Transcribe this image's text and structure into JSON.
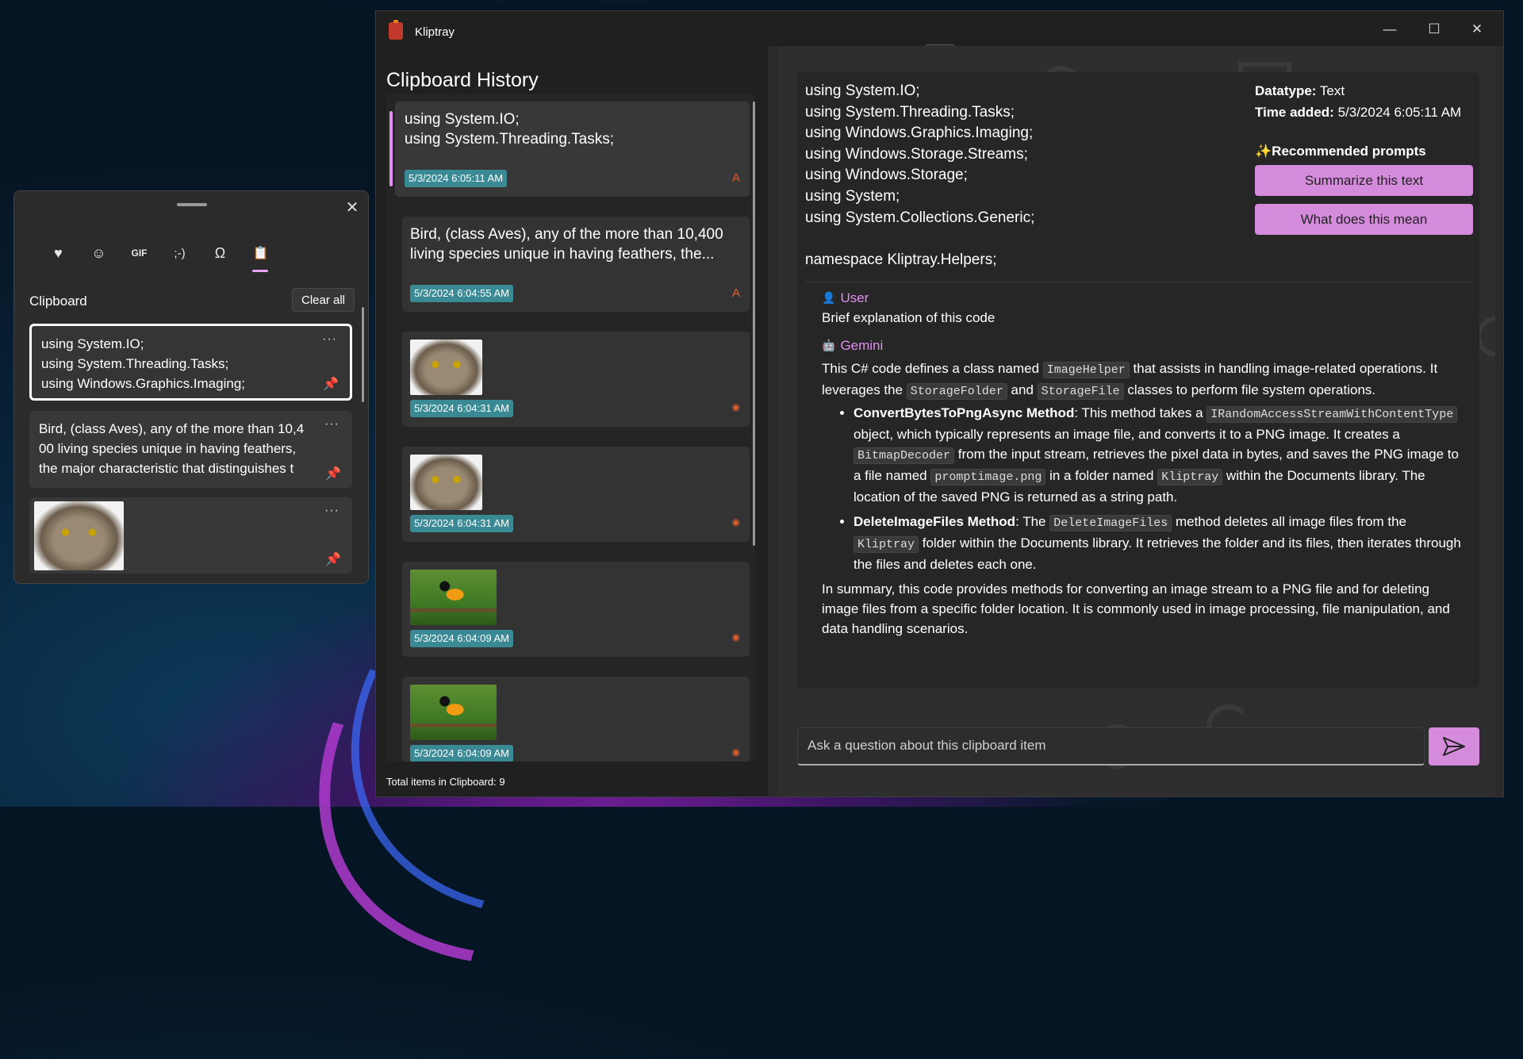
{
  "flyout": {
    "close_icon": "✕",
    "tabs": [
      {
        "name": "favorites-icon",
        "glyph": "♥"
      },
      {
        "name": "emoji-icon",
        "glyph": "☺"
      },
      {
        "name": "gif-icon",
        "glyph": "GIF"
      },
      {
        "name": "kaomoji-icon",
        "glyph": ";-)"
      },
      {
        "name": "symbols-icon",
        "glyph": "Ω"
      },
      {
        "name": "clipboard-icon",
        "glyph": "📋"
      }
    ],
    "heading": "Clipboard",
    "clear_all": "Clear all",
    "items": [
      {
        "text": "using System.IO;\nusing System.Threading.Tasks;\nusing Windows.Graphics.Imaging;"
      },
      {
        "text": "Bird, (class Aves), any of the more than 10,4\n00 living species unique in having feathers,\nthe major characteristic that distinguishes t"
      },
      {
        "text": ""
      }
    ],
    "more_icon": "···",
    "pin_icon": "📌"
  },
  "app": {
    "title": "Kliptray",
    "minimize": "—",
    "maximize": "☐",
    "close": "✕",
    "history_title": "Clipboard History",
    "cards": [
      {
        "text": "using System.IO;\nusing System.Threading.Tasks;",
        "time": "5/3/2024 6:05:11 AM",
        "type": "A"
      },
      {
        "text": "Bird, (class Aves), any of the more than 10,400\nliving species unique in having feathers, the...",
        "time": "5/3/2024 6:04:55 AM",
        "type": "A"
      },
      {
        "text": "",
        "time": "5/3/2024 6:04:31 AM",
        "type": "◉"
      },
      {
        "text": "",
        "time": "5/3/2024 6:04:31 AM",
        "type": "◉"
      },
      {
        "text": "",
        "time": "5/3/2024 6:04:09 AM",
        "type": "◉"
      },
      {
        "text": "",
        "time": "5/3/2024 6:04:09 AM",
        "type": "◉"
      }
    ],
    "total": "Total items in Clipboard: 9",
    "detail": {
      "code": "using System.IO;\nusing System.Threading.Tasks;\nusing Windows.Graphics.Imaging;\nusing Windows.Storage.Streams;\nusing Windows.Storage;\nusing System;\nusing System.Collections.Generic;\n\nnamespace Kliptray.Helpers;",
      "datatype_label": "Datatype:",
      "datatype_value": "Text",
      "time_label": "Time added:",
      "time_value": "5/3/2024 6:05:11 AM",
      "rec_title": "✨Recommended prompts",
      "prompts": [
        "Summarize this text",
        "What does this mean"
      ]
    },
    "chat": {
      "user_role": "User",
      "user_msg": "Brief explanation of this code",
      "bot_role": "Gemini",
      "p1a": "This C# code defines a class named ",
      "c_imagehelper": "ImageHelper",
      "p1b": " that assists in handling image-related operations. It leverages the ",
      "c_storagefolder": "StorageFolder",
      "p1c": " and ",
      "c_storagefile": "StorageFile",
      "p1d": " classes to perform file system operations.",
      "b1_title": "ConvertBytesToPngAsync Method",
      "b1a": ": This method takes a ",
      "c_irandom": "IRandomAccessStreamWithContentType",
      "b1b": " object, which typically represents an image file, and converts it to a PNG image. It creates a ",
      "c_bitmapdecoder": "BitmapDecoder",
      "b1c": " from the input stream, retrieves the pixel data in bytes, and saves the PNG image to a file named ",
      "c_promptimage": "promptimage.png",
      "b1d": " in a folder named ",
      "c_kliptray1": "Kliptray",
      "b1e": " within the Documents library. The location of the saved PNG is returned as a string path.",
      "b2_title": "DeleteImageFiles Method",
      "b2a": ": The ",
      "c_deleteimagefiles": "DeleteImageFiles",
      "b2b": " method deletes all image files from the ",
      "c_kliptray2": "Kliptray",
      "b2c": " folder within the Documents library. It retrieves the folder and its files, then iterates through the files and deletes each one.",
      "summary": "In summary, this code provides methods for converting an image stream to a PNG file and for deleting image files from a specific folder location. It is commonly used in image processing, file manipulation, and data handling scenarios."
    },
    "ask_placeholder": "Ask a question about this clipboard item",
    "send_icon": "send-icon"
  },
  "colors": {
    "accent": "#d48bdc",
    "timestamp": "#3a8a96",
    "type_icon": "#e65c2a"
  }
}
